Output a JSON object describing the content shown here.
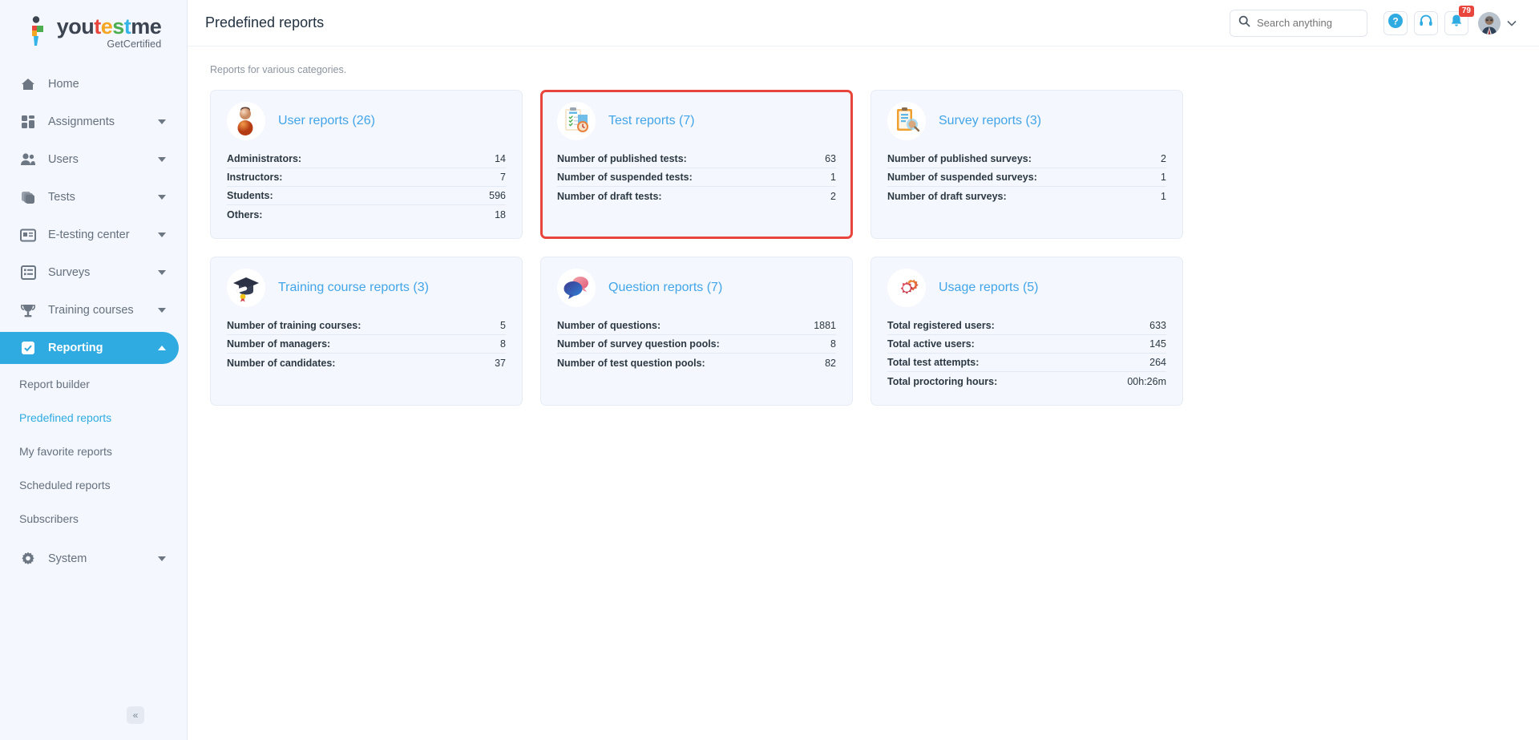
{
  "brand": {
    "word_parts": [
      {
        "text": "you",
        "color": "#3b4450"
      },
      {
        "text": "t",
        "color": "#e8453c"
      },
      {
        "text": "e",
        "color": "#f5a623"
      },
      {
        "text": "s",
        "color": "#4cae50"
      },
      {
        "text": "t",
        "color": "#35b4e8"
      },
      {
        "text": "me",
        "color": "#3b4450"
      }
    ],
    "full_name": "youtestme",
    "tagline": "GetCertified"
  },
  "sidebar": {
    "items": [
      {
        "label": "Home",
        "icon": "home-icon",
        "expandable": false,
        "active": false
      },
      {
        "label": "Assignments",
        "icon": "assignments-icon",
        "expandable": true,
        "active": false
      },
      {
        "label": "Users",
        "icon": "users-icon",
        "expandable": true,
        "active": false
      },
      {
        "label": "Tests",
        "icon": "tests-icon",
        "expandable": true,
        "active": false
      },
      {
        "label": "E-testing center",
        "icon": "etesting-icon",
        "expandable": true,
        "active": false
      },
      {
        "label": "Surveys",
        "icon": "surveys-icon",
        "expandable": true,
        "active": false
      },
      {
        "label": "Training courses",
        "icon": "training-icon",
        "expandable": true,
        "active": false
      },
      {
        "label": "Reporting",
        "icon": "reporting-icon",
        "expandable": true,
        "active": true
      }
    ],
    "subitems": [
      {
        "label": "Report builder",
        "selected": false
      },
      {
        "label": "Predefined reports",
        "selected": true
      },
      {
        "label": "My favorite reports",
        "selected": false
      },
      {
        "label": "Scheduled reports",
        "selected": false
      },
      {
        "label": "Subscribers",
        "selected": false
      }
    ],
    "system": {
      "label": "System",
      "icon": "gear-icon",
      "expandable": true
    },
    "collapse_label": "«",
    "active_color": "#2fabe1"
  },
  "header": {
    "title": "Predefined reports",
    "search_placeholder": "Search anything",
    "search_value": "",
    "help_label": "?",
    "notification_count": "79",
    "chevron": "⌄"
  },
  "main": {
    "subtitle": "Reports for various categories.",
    "cards": [
      {
        "title": "User reports (26)",
        "icon": "user-avatar-icon",
        "highlighted": false,
        "rows": [
          {
            "label": "Administrators:",
            "value": "14"
          },
          {
            "label": "Instructors:",
            "value": "7"
          },
          {
            "label": "Students:",
            "value": "596"
          },
          {
            "label": "Others:",
            "value": "18"
          }
        ]
      },
      {
        "title": "Test reports (7)",
        "icon": "clipboard-test-icon",
        "highlighted": true,
        "rows": [
          {
            "label": "Number of published tests:",
            "value": "63"
          },
          {
            "label": "Number of suspended tests:",
            "value": "1"
          },
          {
            "label": "Number of draft tests:",
            "value": "2"
          }
        ]
      },
      {
        "title": "Survey reports (3)",
        "icon": "survey-clipboard-icon",
        "highlighted": false,
        "rows": [
          {
            "label": "Number of published surveys:",
            "value": "2"
          },
          {
            "label": "Number of suspended surveys:",
            "value": "1"
          },
          {
            "label": "Number of draft surveys:",
            "value": "1"
          }
        ]
      },
      {
        "title": "Training course reports (3)",
        "icon": "graduation-cap-icon",
        "highlighted": false,
        "rows": [
          {
            "label": "Number of training courses:",
            "value": "5"
          },
          {
            "label": "Number of managers:",
            "value": "8"
          },
          {
            "label": "Number of candidates:",
            "value": "37"
          }
        ]
      },
      {
        "title": "Question reports (7)",
        "icon": "speech-bubbles-icon",
        "highlighted": false,
        "rows": [
          {
            "label": "Number of questions:",
            "value": "1881"
          },
          {
            "label": "Number of survey question pools:",
            "value": "8"
          },
          {
            "label": "Number of test question pools:",
            "value": "82"
          }
        ]
      },
      {
        "title": "Usage reports (5)",
        "icon": "gears-icon",
        "highlighted": false,
        "rows": [
          {
            "label": "Total registered users:",
            "value": "633"
          },
          {
            "label": "Total active users:",
            "value": "145"
          },
          {
            "label": "Total test attempts:",
            "value": "264"
          },
          {
            "label": "Total proctoring hours:",
            "value": "00h:26m"
          }
        ]
      }
    ],
    "highlight_color": "#e8453c",
    "card_title_color": "#42a5e8"
  }
}
